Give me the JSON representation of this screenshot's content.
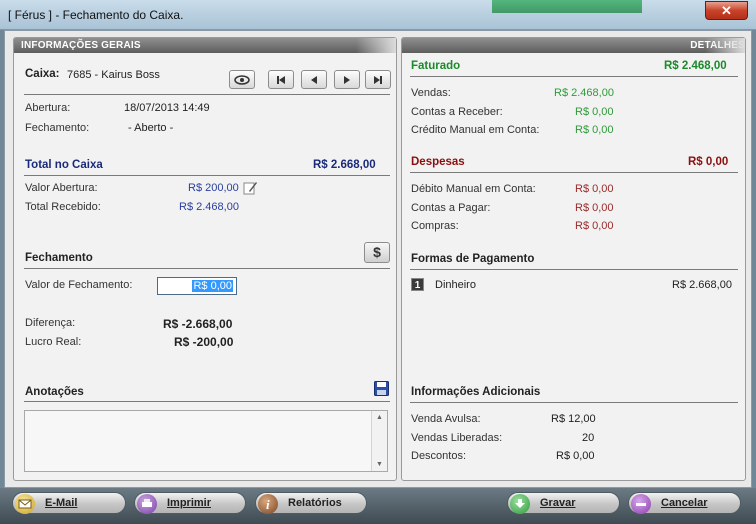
{
  "window": {
    "title": "[ Férus ] - Fechamento do Caixa.",
    "close_label": "✕"
  },
  "left": {
    "header": "INFORMAÇÕES GERAIS",
    "caixa_label": "Caixa:",
    "caixa_value": "7685 - Kairus Boss",
    "abertura_label": "Abertura:",
    "abertura_value": "18/07/2013 14:49",
    "fechamento_label": "Fechamento:",
    "fechamento_value": "- Aberto -",
    "total_caixa_label": "Total no Caixa",
    "total_caixa_value": "R$ 2.668,00",
    "valor_abertura_label": "Valor Abertura:",
    "valor_abertura_value": "R$ 200,00",
    "total_recebido_label": "Total Recebido:",
    "total_recebido_value": "R$ 2.468,00",
    "fechamento_section": "Fechamento",
    "dollar_label": "$",
    "valor_fechamento_label": "Valor de Fechamento:",
    "valor_fechamento_value": "R$ 0,00",
    "diferenca_label": "Diferença:",
    "diferenca_value": "R$ -2.668,00",
    "lucro_label": "Lucro Real:",
    "lucro_value": "R$ -200,00",
    "anotacoes_label": "Anotações",
    "notes_value": ""
  },
  "right": {
    "header": "DETALHES",
    "faturado_label": "Faturado",
    "faturado_value": "R$ 2.468,00",
    "vendas_label": "Vendas:",
    "vendas_value": "R$ 2.468,00",
    "contas_receber_label": "Contas a Receber:",
    "contas_receber_value": "R$ 0,00",
    "credito_label": "Crédito Manual em Conta:",
    "credito_value": "R$ 0,00",
    "despesas_label": "Despesas",
    "despesas_value": "R$ 0,00",
    "debito_label": "Débito Manual em Conta:",
    "debito_value": "R$ 0,00",
    "contas_pagar_label": "Contas a Pagar:",
    "contas_pagar_value": "R$ 0,00",
    "compras_label": "Compras:",
    "compras_value": "R$ 0,00",
    "formas_label": "Formas de Pagamento",
    "formas_items": [
      {
        "index": "1",
        "name": "Dinheiro",
        "value": "R$ 2.668,00"
      }
    ],
    "info_label": "Informações Adicionais",
    "venda_avulsa_label": "Venda Avulsa:",
    "venda_avulsa_value": "R$ 12,00",
    "vendas_liberadas_label": "Vendas Liberadas:",
    "vendas_liberadas_value": "20",
    "descontos_label": "Descontos:",
    "descontos_value": "R$ 0,00"
  },
  "toolbar": {
    "email_label": "E-Mail",
    "imprimir_label": "Imprimir",
    "relatorios_label": "Relatórios",
    "gravar_label": "Gravar",
    "cancelar_label": "Cancelar"
  },
  "colors": {
    "faturado": "#1a8a2a",
    "despesas": "#8a1010",
    "total": "#1a2a7a"
  }
}
